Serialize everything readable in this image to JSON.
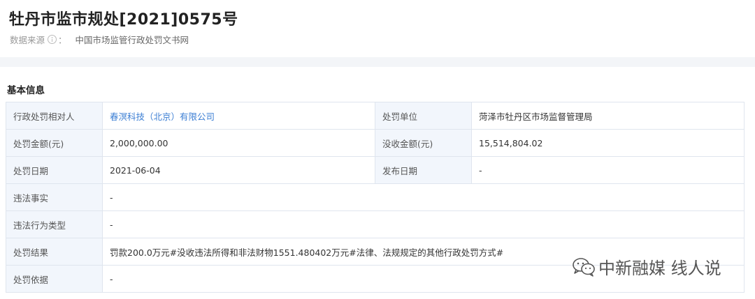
{
  "header": {
    "title": "牡丹市监市规处[2021]0575号",
    "source_label": "数据来源",
    "source_colon": "：",
    "source_value": "中国市场监管行政处罚文书网"
  },
  "section": {
    "title": "基本信息"
  },
  "table": {
    "rows": [
      {
        "label": "行政处罚相对人",
        "value": "春溟科技（北京）有限公司",
        "label2": "处罚单位",
        "value2": "菏泽市牡丹区市场监督管理局"
      },
      {
        "label": "处罚金额(元)",
        "value": "2,000,000.00",
        "label2": "没收金额(元)",
        "value2": "15,514,804.02"
      },
      {
        "label": "处罚日期",
        "value": "2021-06-04",
        "label2": "发布日期",
        "value2": "-"
      },
      {
        "label": "违法事实",
        "value": "-"
      },
      {
        "label": "违法行为类型",
        "value": "-"
      },
      {
        "label": "处罚结果",
        "value": "罚款200.0万元#没收违法所得和非法财物1551.480402万元#法律、法规规定的其他行政处罚方式#"
      },
      {
        "label": "处罚依据",
        "value": "-"
      }
    ]
  },
  "watermark": {
    "text": "中新融媒 线人说",
    "icon": "wechat-icon"
  },
  "colors": {
    "link": "#3d7fd4",
    "label_bg": "#f2f6fc",
    "border": "#dfe5ee",
    "band": "#f3f5f8"
  }
}
